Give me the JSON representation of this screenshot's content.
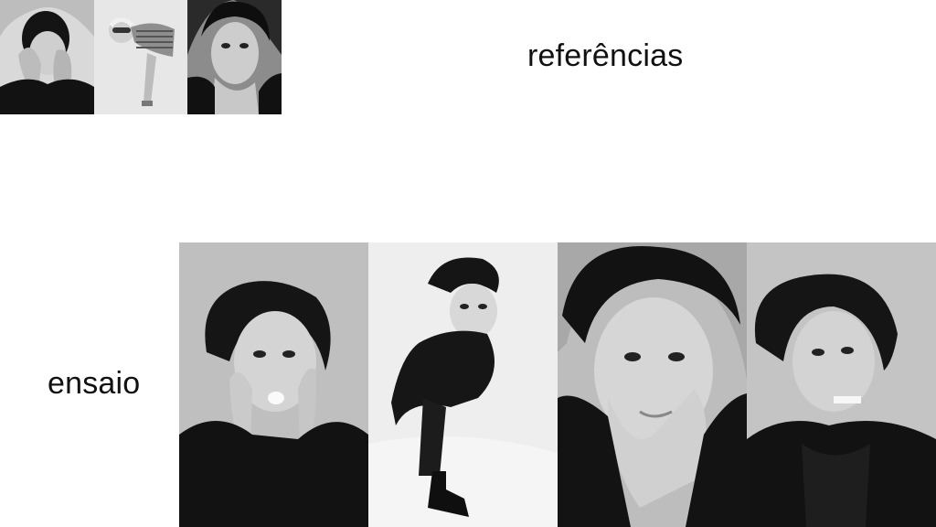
{
  "sections": {
    "references": {
      "title": "referências"
    },
    "rehearsal": {
      "title": "ensaio"
    }
  },
  "reference_photos": [
    {
      "name": "reference-photo-hands-on-face"
    },
    {
      "name": "reference-photo-leaning-pose"
    },
    {
      "name": "reference-photo-hand-on-chin"
    }
  ],
  "rehearsal_photos": [
    {
      "name": "rehearsal-photo-hands-on-cheeks"
    },
    {
      "name": "rehearsal-photo-full-body-lean"
    },
    {
      "name": "rehearsal-photo-hands-on-chin"
    },
    {
      "name": "rehearsal-photo-grimace"
    }
  ]
}
